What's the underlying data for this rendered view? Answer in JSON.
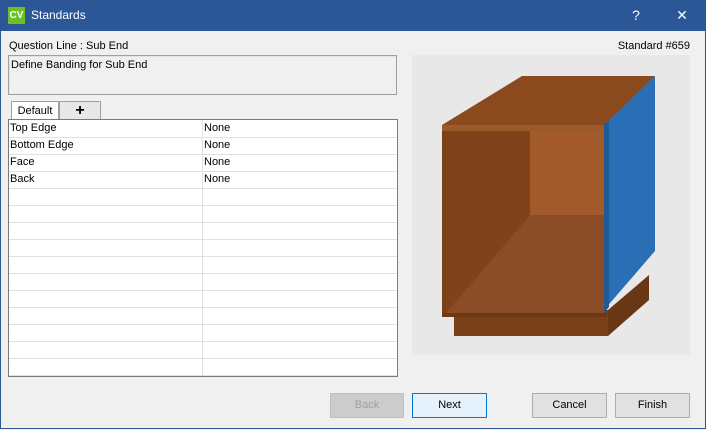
{
  "window": {
    "logo_text": "CV",
    "title": "Standards",
    "help_label": "?",
    "close_label": "✕",
    "brand_color": "#2b5797"
  },
  "header": {
    "question_line": "Question Line : Sub End",
    "standard_number": "Standard #659",
    "description": "Define Banding for Sub End"
  },
  "tabs": [
    {
      "label": "Default",
      "selected": true
    },
    {
      "label": "+",
      "icon": "plus-icon"
    }
  ],
  "grid": {
    "rows": [
      {
        "name": "Top Edge",
        "value": "None"
      },
      {
        "name": "Bottom Edge",
        "value": "None"
      },
      {
        "name": "Face",
        "value": "None"
      },
      {
        "name": "Back",
        "value": "None"
      }
    ],
    "empty_rows": 11
  },
  "preview": {
    "cabinet_color": "#7a4019",
    "highlight_color": "#2a6fb5"
  },
  "buttons": {
    "back": "Back",
    "next": "Next",
    "cancel": "Cancel",
    "finish": "Finish"
  }
}
